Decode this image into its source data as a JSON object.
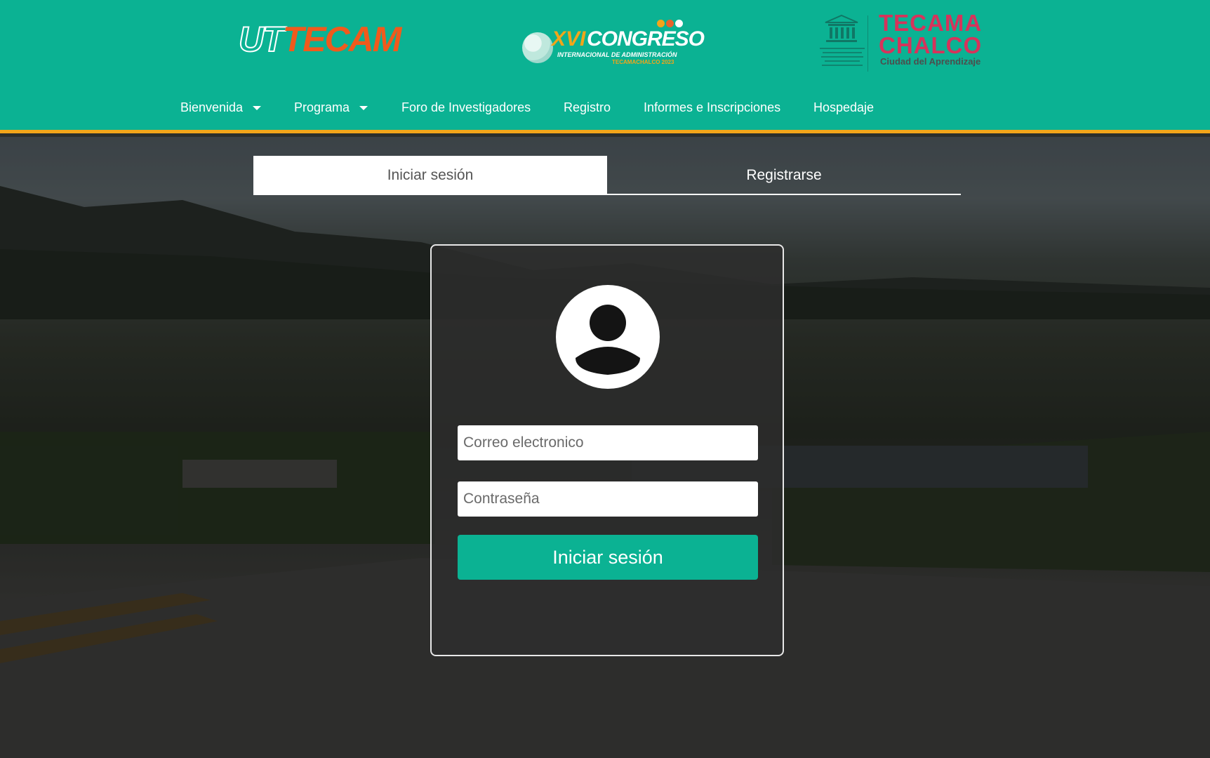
{
  "colors": {
    "header_bg": "#0bb293",
    "header_border": "#f2a51a",
    "button_bg": "#0bb293",
    "nav_text": "#ffffff"
  },
  "logos": {
    "utecam": {
      "ut": "UT",
      "rest": "TECAM"
    },
    "congreso": {
      "numeral": "XVI",
      "word": "CONGRESO",
      "subtitle": "INTERNACIONAL DE ADMINISTRACIÓN",
      "tagline": "TECAMACHALCO 2023"
    },
    "tecama": {
      "line1": "TECAMA",
      "line2": "CHALCO",
      "subtitle": "Ciudad del Aprendizaje"
    }
  },
  "nav": {
    "items": [
      {
        "label": "Bienvenida",
        "dropdown": true
      },
      {
        "label": "Programa",
        "dropdown": true
      },
      {
        "label": "Foro de Investigadores",
        "dropdown": false
      },
      {
        "label": "Registro",
        "dropdown": false
      },
      {
        "label": "Informes e Inscripciones",
        "dropdown": false
      },
      {
        "label": "Hospedaje",
        "dropdown": false
      }
    ]
  },
  "tabs": {
    "login": "Iniciar sesión",
    "register": "Registrarse",
    "active": "login"
  },
  "login_form": {
    "avatar_icon": "user-avatar-icon",
    "email_placeholder": "Correo electronico",
    "email_value": "",
    "password_placeholder": "Contraseña",
    "password_value": "",
    "submit_label": "Iniciar sesión"
  }
}
